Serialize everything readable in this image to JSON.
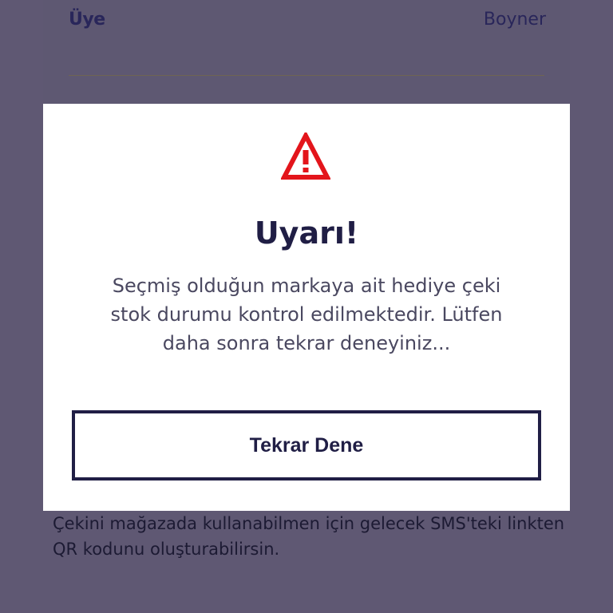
{
  "background_form": {
    "row": {
      "label": "Üye",
      "value": "Boyner"
    },
    "info_text": "Çekini mağazada kullanabilmen için gelecek SMS'teki linkten QR kodunu oluşturabilirsin."
  },
  "modal": {
    "icon": "warning-triangle-icon",
    "title": "Uyarı!",
    "message": "Seçmiş olduğun markaya ait hediye çeki stok durumu kontrol edilmektedir. Lütfen daha sonra tekrar deneyiniz...",
    "button_label": "Tekrar Dene"
  },
  "colors": {
    "overlay": "#5f5873",
    "modal_bg": "#ffffff",
    "primary_text": "#201e45",
    "warning_red": "#e3151b"
  }
}
